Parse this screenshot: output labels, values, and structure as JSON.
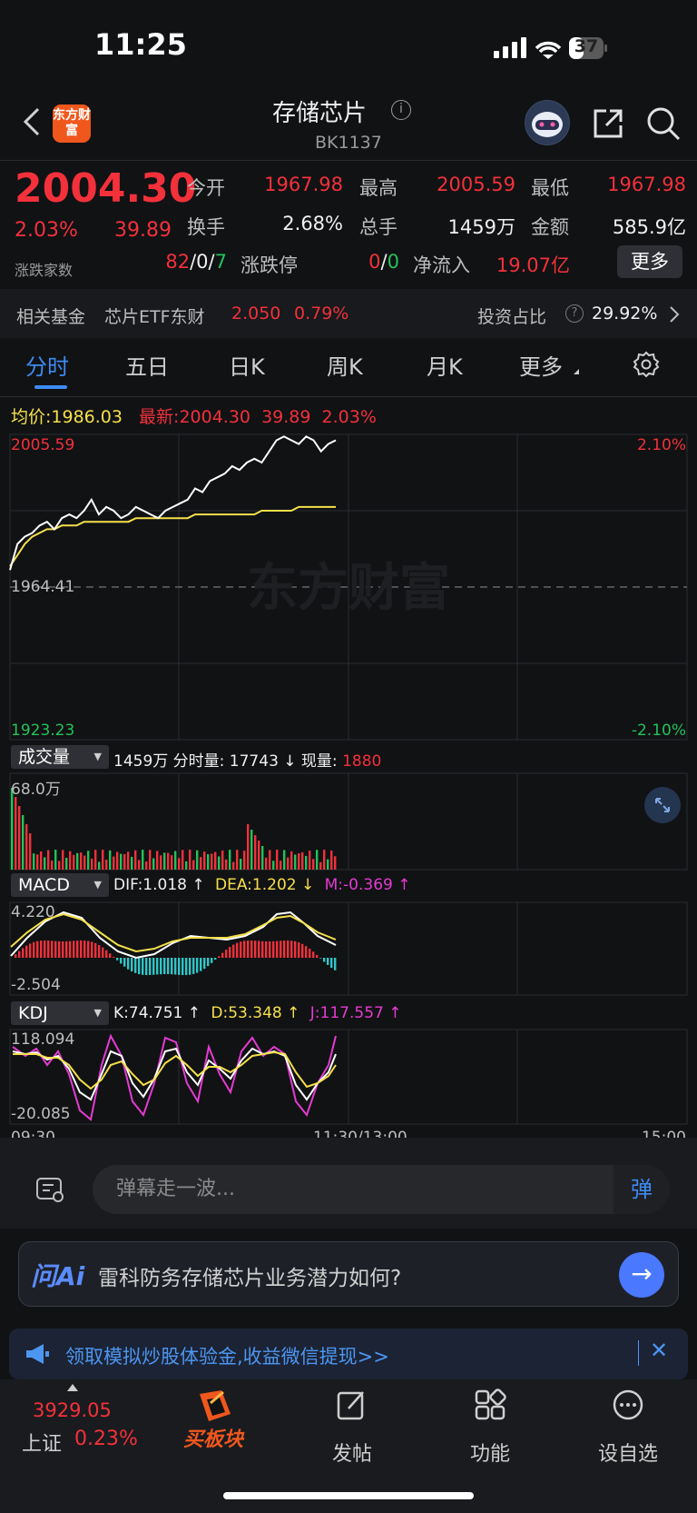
{
  "status": {
    "time": "11:25",
    "battery": "37"
  },
  "header": {
    "logo_text": "东方财富",
    "title": "存储芯片",
    "code": "BK1137"
  },
  "quote": {
    "last_price": "2004.30",
    "pct": "2.03%",
    "change": "39.89",
    "open_label": "今开",
    "open": "1967.98",
    "high_label": "最高",
    "high": "2005.59",
    "low_label": "最低",
    "low": "1967.98",
    "turnover_label": "换手",
    "turnover": "2.68%",
    "volume_label": "总手",
    "volume": "1459万",
    "amount_label": "金额",
    "amount": "585.9亿",
    "updown_label": "涨跌家数",
    "up": "82",
    "flat": "0",
    "down": "7",
    "limit_label": "涨跌停",
    "limit_up": "0",
    "limit_down": "0",
    "netflow_label": "净流入",
    "netflow": "19.07亿",
    "more_label": "更多"
  },
  "fund": {
    "label": "相关基金",
    "name": "芯片ETF东财",
    "price": "2.050",
    "pct": "0.79%",
    "ratio_label": "投资占比",
    "ratio": "29.92%"
  },
  "tabs": [
    {
      "label": "分时"
    },
    {
      "label": "五日"
    },
    {
      "label": "日K"
    },
    {
      "label": "周K"
    },
    {
      "label": "月K"
    },
    {
      "label": "更多"
    }
  ],
  "chart_legend": {
    "avg_label": "均价:",
    "avg": "1986.03",
    "latest_label": "最新:",
    "latest": "2004.30",
    "chg": "39.89",
    "pct": "2.03%"
  },
  "chart_data": [
    {
      "type": "line",
      "title": "分时",
      "x_labels": [
        "09:30",
        "11:30/13:00",
        "15:00"
      ],
      "ylim": [
        1923.23,
        2005.59
      ],
      "y_labels_left": [
        "2005.59",
        "1964.41",
        "1923.23"
      ],
      "y_labels_right": [
        "2.10%",
        "-2.10%"
      ],
      "prev_close": 1964.41,
      "watermark": "东方财富",
      "series": [
        {
          "name": "最新",
          "color": "#ffffff",
          "values": [
            1969,
            1976,
            1978,
            1979,
            1981,
            1982,
            1980,
            1983,
            1984,
            1983,
            1985,
            1988,
            1984,
            1986,
            1985,
            1983,
            1984,
            1986,
            1985,
            1984,
            1983,
            1985,
            1986,
            1987,
            1988,
            1991,
            1990,
            1993,
            1994,
            1995,
            1997,
            1996,
            1998,
            1999,
            1998,
            2001,
            2004,
            2005,
            2004,
            2003,
            2005,
            2004,
            2001,
            2003,
            2004
          ]
        },
        {
          "name": "均价",
          "color": "#f5e04b",
          "values": [
            1970,
            1973,
            1976,
            1978,
            1979,
            1980,
            1980,
            1981,
            1981,
            1981,
            1982,
            1982,
            1982,
            1982,
            1982,
            1982,
            1982,
            1983,
            1983,
            1983,
            1983,
            1983,
            1983,
            1983,
            1983,
            1984,
            1984,
            1984,
            1984,
            1984,
            1984,
            1984,
            1984,
            1984,
            1985,
            1985,
            1985,
            1985,
            1985,
            1986,
            1986,
            1986,
            1986,
            1986,
            1986
          ]
        }
      ],
      "grid": true
    },
    {
      "type": "bar",
      "title": "成交量",
      "summary": "1459万",
      "stats": "分时量: 17743 ↓ 现量:",
      "current": "1880",
      "ymax_label": "68.0万"
    },
    {
      "type": "bar",
      "title": "MACD",
      "dif": "DIF:1.018 ↑",
      "dea": "DEA:1.202 ↓",
      "m": "M:-0.369 ↑",
      "y_labels": [
        "4.220",
        "-2.504"
      ]
    },
    {
      "type": "line",
      "title": "KDJ",
      "k": "K:74.751 ↑",
      "d": "D:53.348 ↑",
      "j": "J:117.557 ↑",
      "y_labels": [
        "118.094",
        "-20.085"
      ]
    }
  ],
  "danmu": {
    "placeholder": "弹幕走一波...",
    "send": "弹"
  },
  "ai": {
    "logo": "问Ai",
    "question": "雷科防务存储芯片业务潜力如何?"
  },
  "promo": {
    "text": "领取模拟炒股体验金,收益微信提现>>"
  },
  "bottom_nav": {
    "index_value": "3929.05",
    "index_name": "上证",
    "index_pct": "0.23%",
    "buy_label": "买板块",
    "post_label": "发帖",
    "func_label": "功能",
    "watch_label": "设自选"
  }
}
